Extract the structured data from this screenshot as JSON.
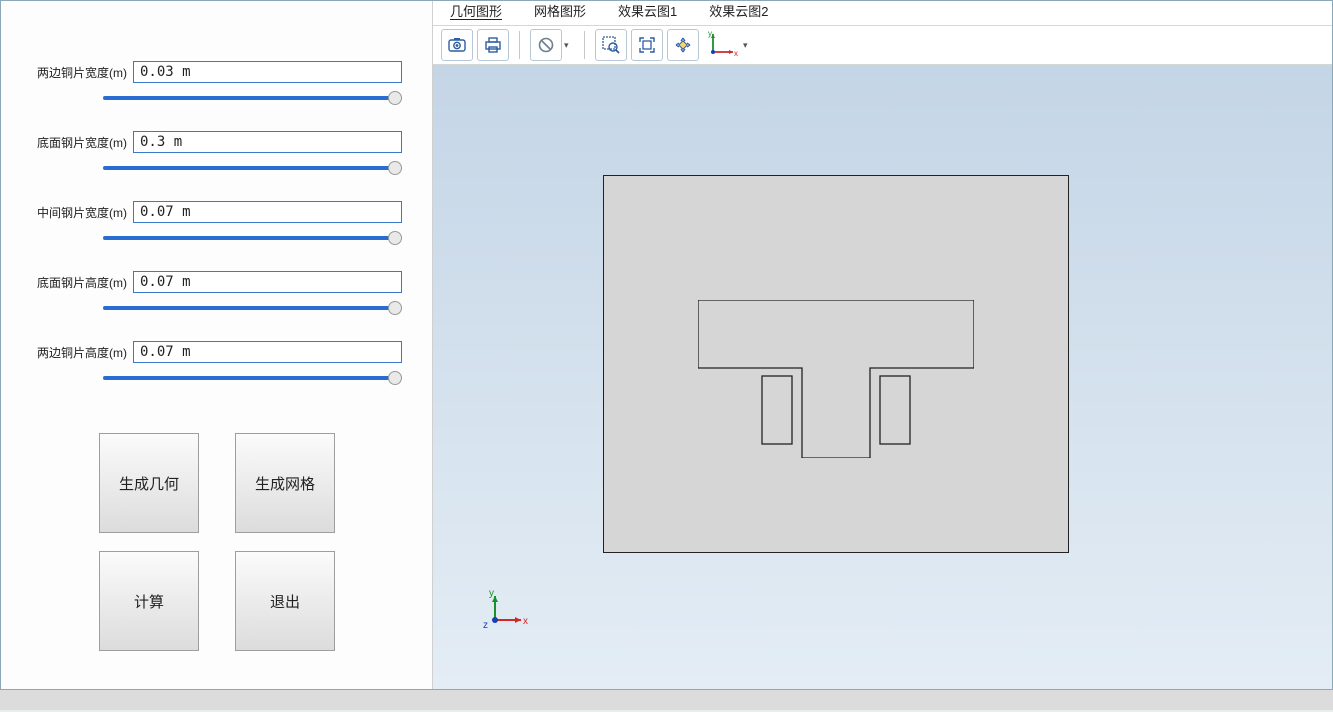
{
  "params": [
    {
      "label": "两边铜片宽度(m)",
      "value": "0.03 m"
    },
    {
      "label": "底面钢片宽度(m)",
      "value": "0.3 m"
    },
    {
      "label": "中间钢片宽度(m)",
      "value": "0.07 m"
    },
    {
      "label": "底面钢片高度(m)",
      "value": "0.07 m"
    },
    {
      "label": "两边铜片高度(m)",
      "value": "0.07 m"
    }
  ],
  "buttons": {
    "gen_geometry": "生成几何",
    "gen_mesh": "生成网格",
    "calculate": "计算",
    "exit": "退出"
  },
  "tabs": {
    "geometry": "几何图形",
    "mesh": "网格图形",
    "cloud1": "效果云图1",
    "cloud2": "效果云图2"
  },
  "axis": {
    "x": "x",
    "y": "y",
    "z": "z"
  },
  "toolbar_icons": {
    "screenshot": "screenshot-icon",
    "print": "print-icon",
    "reset": "reset-icon",
    "zoom_box": "zoom-box-icon",
    "fit_extents": "fit-extents-icon",
    "rotate": "rotate-icon",
    "axes": "axes-icon"
  }
}
